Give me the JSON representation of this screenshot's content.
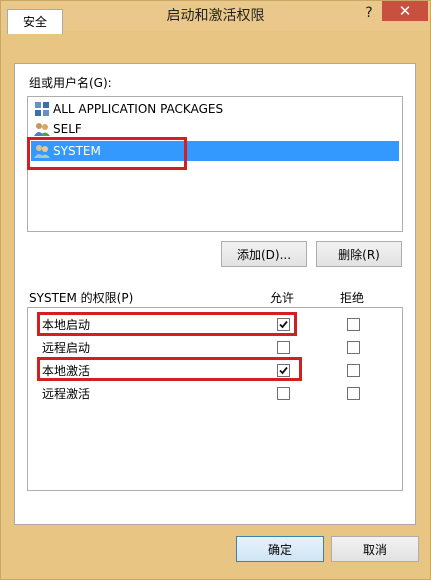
{
  "window": {
    "title": "启动和激活权限",
    "help_glyph": "?",
    "close_glyph": "✕"
  },
  "tabs": [
    {
      "label": "安全"
    }
  ],
  "groups": {
    "label": "组或用户名(G):",
    "items": [
      {
        "label": "ALL APPLICATION PACKAGES",
        "icon": "packages-icon",
        "selected": false
      },
      {
        "label": "SELF",
        "icon": "users-icon",
        "selected": false
      },
      {
        "label": "SYSTEM",
        "icon": "users-icon",
        "selected": true
      }
    ]
  },
  "buttons": {
    "add": "添加(D)...",
    "remove": "删除(R)",
    "ok": "确定",
    "cancel": "取消"
  },
  "permissions": {
    "label": "SYSTEM 的权限(P)",
    "allow_header": "允许",
    "deny_header": "拒绝",
    "rows": [
      {
        "name": "本地启动",
        "allow": true,
        "deny": false
      },
      {
        "name": "远程启动",
        "allow": false,
        "deny": false
      },
      {
        "name": "本地激活",
        "allow": true,
        "deny": false
      },
      {
        "name": "远程激活",
        "allow": false,
        "deny": false
      }
    ]
  },
  "annotations": {
    "highlight_color": "#d21f1f"
  }
}
